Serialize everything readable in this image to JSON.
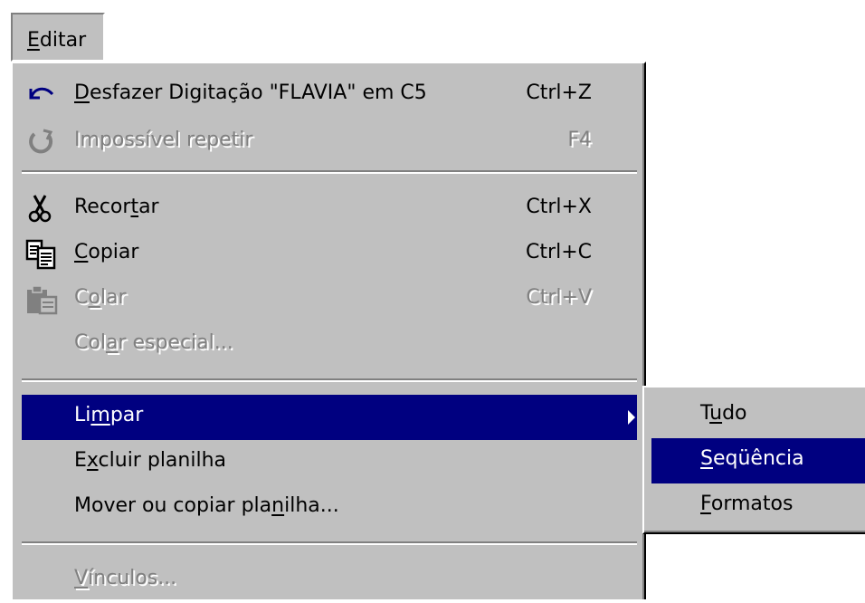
{
  "menubar": {
    "label_pre": "",
    "label_ul": "E",
    "label_post": "ditar"
  },
  "menu": {
    "items": [
      {
        "pre": "",
        "ul": "D",
        "post": "esfazer Digitação \"FLAVIA\" em C5",
        "shortcut": "Ctrl+Z",
        "icon": "undo-icon",
        "enabled": true
      },
      {
        "pre": "",
        "ul": "",
        "post": "Impossível repetir",
        "shortcut": "F4",
        "icon": "redo-icon",
        "enabled": false
      },
      {
        "pre": "Recor",
        "ul": "t",
        "post": "ar",
        "shortcut": "Ctrl+X",
        "icon": "scissors-icon",
        "enabled": true
      },
      {
        "pre": "",
        "ul": "C",
        "post": "opiar",
        "shortcut": "Ctrl+C",
        "icon": "copy-icon",
        "enabled": true
      },
      {
        "pre": "C",
        "ul": "o",
        "post": "lar",
        "shortcut": "Ctrl+V",
        "icon": "paste-icon",
        "enabled": false
      },
      {
        "pre": "Col",
        "ul": "a",
        "post": "r especial...",
        "shortcut": "",
        "icon": "",
        "enabled": false
      },
      {
        "pre": "Li",
        "ul": "m",
        "post": "par",
        "shortcut": "",
        "icon": "",
        "enabled": true,
        "highlighted": true
      },
      {
        "pre": "E",
        "ul": "x",
        "post": "cluir planilha",
        "shortcut": "",
        "icon": "",
        "enabled": true
      },
      {
        "pre": "Mover ou copiar pla",
        "ul": "n",
        "post": "ilha...",
        "shortcut": "",
        "icon": "",
        "enabled": true
      },
      {
        "pre": "",
        "ul": "V",
        "post": "ínculos...",
        "shortcut": "",
        "icon": "",
        "enabled": false
      }
    ]
  },
  "submenu": {
    "items": [
      {
        "pre": "T",
        "ul": "u",
        "post": "do"
      },
      {
        "pre": "",
        "ul": "S",
        "post": "eqüência",
        "highlighted": true
      },
      {
        "pre": "",
        "ul": "F",
        "post": "ormatos"
      }
    ]
  },
  "colors": {
    "menu_bg": "#c0c0c0",
    "highlight": "#000080",
    "disabled": "#808080"
  }
}
